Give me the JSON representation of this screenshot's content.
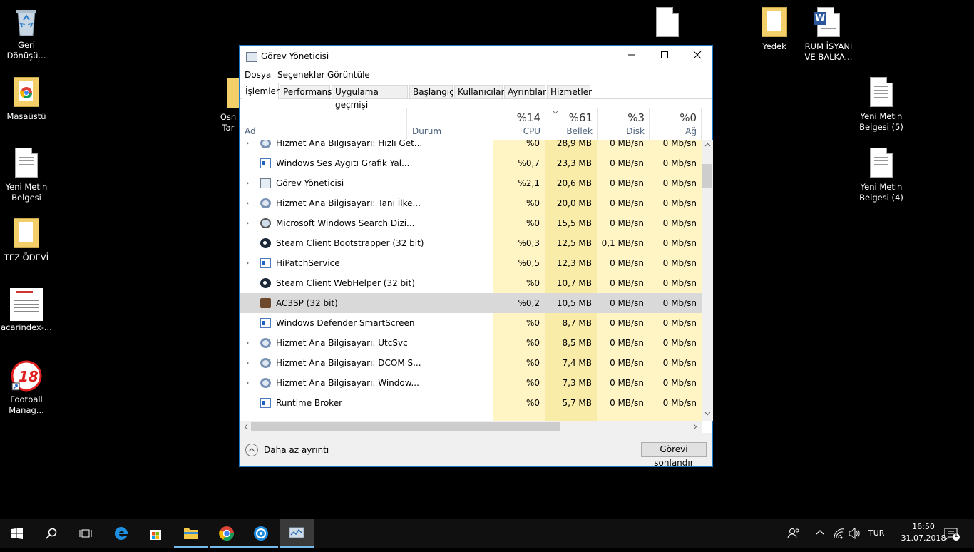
{
  "desktop": {
    "icons_left": [
      {
        "label": "Geri Dönüşü...",
        "icon": "recycle-bin-icon"
      },
      {
        "label": "Masaüstü",
        "icon": "folder-chrome-icon"
      },
      {
        "label": "Yeni Metin Belgesi",
        "icon": "text-document-icon"
      },
      {
        "label": "TEZ ÖDEVİ",
        "icon": "folder-icon"
      },
      {
        "label": "acarindex-...",
        "icon": "pdf-thumbnail-icon"
      },
      {
        "label": "Football Manag...",
        "icon": "football-manager-icon"
      }
    ],
    "icons_right": [
      {
        "label": "Yedek",
        "icon": "folder-icon"
      },
      {
        "label": "RUM İSYANI VE BALKA...",
        "icon": "word-document-icon"
      },
      {
        "label": "Yeni Metin Belgesi (5)",
        "icon": "text-document-icon"
      },
      {
        "label": "Yeni Metin Belgesi (4)",
        "icon": "text-document-icon"
      }
    ],
    "partial_label_osn": "Osn",
    "partial_label_tar": "Tar"
  },
  "window": {
    "title": "Görev Yöneticisi",
    "menu": [
      "Dosya",
      "Seçenekler",
      "Görüntüle"
    ],
    "tabs": [
      "İşlemler",
      "Performans",
      "Uygulama geçmişi",
      "Başlangıç",
      "Kullanıcılar",
      "Ayrıntılar",
      "Hizmetler"
    ],
    "columns": {
      "name": "Ad",
      "status": "Durum",
      "cpu": {
        "pct": "%14",
        "label": "CPU"
      },
      "memory": {
        "pct": "%61",
        "label": "Bellek"
      },
      "disk": {
        "pct": "%3",
        "label": "Disk"
      },
      "network": {
        "pct": "%0",
        "label": "Ağ"
      }
    },
    "rows": [
      {
        "expand": true,
        "icon": "gear",
        "name": "Hizmet Ana Bilgisayarı: Hızlı Get...",
        "cpu": "%0",
        "mem": "28,9 MB",
        "disk": "0 MB/sn",
        "net": "0 Mb/sn"
      },
      {
        "expand": false,
        "icon": "box",
        "name": "Windows Ses Aygıtı Grafik Yal...",
        "cpu": "%0,7",
        "mem": "23,3 MB",
        "disk": "0 MB/sn",
        "net": "0 Mb/sn"
      },
      {
        "expand": true,
        "icon": "tm",
        "name": "Görev Yöneticisi",
        "cpu": "%2,1",
        "mem": "20,6 MB",
        "disk": "0 MB/sn",
        "net": "0 Mb/sn"
      },
      {
        "expand": true,
        "icon": "gear",
        "name": "Hizmet Ana Bilgisayarı: Tanı İlke...",
        "cpu": "%0",
        "mem": "20,0 MB",
        "disk": "0 MB/sn",
        "net": "0 Mb/sn"
      },
      {
        "expand": true,
        "icon": "search",
        "name": "Microsoft Windows Search Dizi...",
        "cpu": "%0",
        "mem": "15,5 MB",
        "disk": "0 MB/sn",
        "net": "0 Mb/sn"
      },
      {
        "expand": false,
        "icon": "steam",
        "name": "Steam Client Bootstrapper (32 bit)",
        "cpu": "%0,3",
        "mem": "12,5 MB",
        "disk": "0,1 MB/sn",
        "net": "0 Mb/sn"
      },
      {
        "expand": true,
        "icon": "box",
        "name": "HiPatchService",
        "cpu": "%0,5",
        "mem": "12,3 MB",
        "disk": "0 MB/sn",
        "net": "0 Mb/sn"
      },
      {
        "expand": false,
        "icon": "steam",
        "name": "Steam Client WebHelper (32 bit)",
        "cpu": "%0",
        "mem": "10,7 MB",
        "disk": "0 MB/sn",
        "net": "0 Mb/sn"
      },
      {
        "expand": false,
        "icon": "ac3",
        "name": "AC3SP (32 bit)",
        "cpu": "%0,2",
        "mem": "10,5 MB",
        "disk": "0 MB/sn",
        "net": "0 Mb/sn",
        "selected": true
      },
      {
        "expand": false,
        "icon": "box",
        "name": "Windows Defender SmartScreen",
        "cpu": "%0",
        "mem": "8,7 MB",
        "disk": "0 MB/sn",
        "net": "0 Mb/sn"
      },
      {
        "expand": true,
        "icon": "gear",
        "name": "Hizmet Ana Bilgisayarı: UtcSvc",
        "cpu": "%0",
        "mem": "8,5 MB",
        "disk": "0 MB/sn",
        "net": "0 Mb/sn"
      },
      {
        "expand": true,
        "icon": "gear",
        "name": "Hizmet Ana Bilgisayarı: DCOM S...",
        "cpu": "%0",
        "mem": "7,4 MB",
        "disk": "0 MB/sn",
        "net": "0 Mb/sn"
      },
      {
        "expand": true,
        "icon": "gear",
        "name": "Hizmet Ana Bilgisayarı: Window...",
        "cpu": "%0",
        "mem": "7,3 MB",
        "disk": "0 MB/sn",
        "net": "0 Mb/sn"
      },
      {
        "expand": false,
        "icon": "box",
        "name": "Runtime Broker",
        "cpu": "%0",
        "mem": "5,7 MB",
        "disk": "0 MB/sn",
        "net": "0 Mb/sn"
      }
    ],
    "footer": {
      "less_details": "Daha az ayrıntı",
      "end_task": "Görevi sonlandır"
    }
  },
  "taskbar": {
    "items": [
      "windows-start-icon",
      "search-icon",
      "task-view-icon",
      "edge-icon",
      "store-icon",
      "file-explorer-icon",
      "chrome-icon",
      "uplay-icon",
      "task-manager-icon"
    ],
    "language": "TUR",
    "time": "16:50",
    "date": "31.07.2018",
    "notification_count": "1"
  },
  "colors": {
    "heat_light": "#fff4c4",
    "heat_medium": "#f9eca8",
    "selected_row": "#d9d9d9",
    "window_border": "#1979ca",
    "taskbar_bg": "#101010"
  }
}
